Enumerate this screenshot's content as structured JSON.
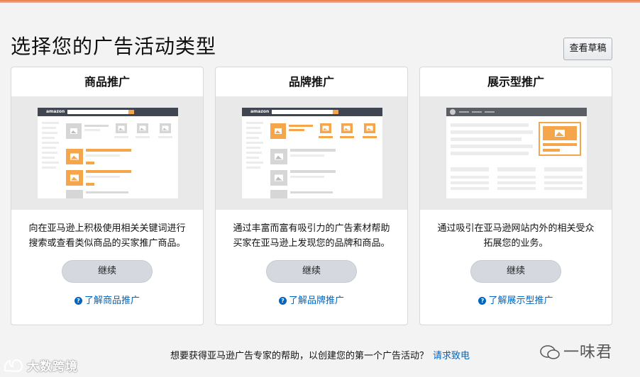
{
  "header": {
    "title": "选择您的广告活动类型",
    "drafts_label": "查看草稿"
  },
  "cards": [
    {
      "title": "商品推广",
      "desc_line1": "向在亚马逊上积极使用相关关键词进行",
      "desc_line2": "搜索或查看类似商品的买家推广商品。",
      "continue_label": "继续",
      "learn_label": "了解商品推广"
    },
    {
      "title": "品牌推广",
      "desc_line1": "通过丰富而富有吸引力的广告素材帮助",
      "desc_line2": "买家在亚马逊上发现您的品牌和商品。",
      "continue_label": "继续",
      "learn_label": "了解品牌推广"
    },
    {
      "title": "展示型推广",
      "desc_line1": "通过吸引在亚马逊网站内外的相关受众",
      "desc_line2": "拓展您的业务。",
      "continue_label": "继续",
      "learn_label": "了解展示型推广"
    }
  ],
  "mock": {
    "logo_text": "amazon"
  },
  "footer": {
    "text": "想要获得亚马逊广告专家的帮助，以创建您的第一个广告活动？",
    "link": "请求致电"
  },
  "watermarks": {
    "left": "大数跨境",
    "right": "一味君"
  },
  "colors": {
    "accent_orange": "#f5a64a",
    "link_blue": "#0066c0",
    "header_dark": "#3f4652"
  }
}
